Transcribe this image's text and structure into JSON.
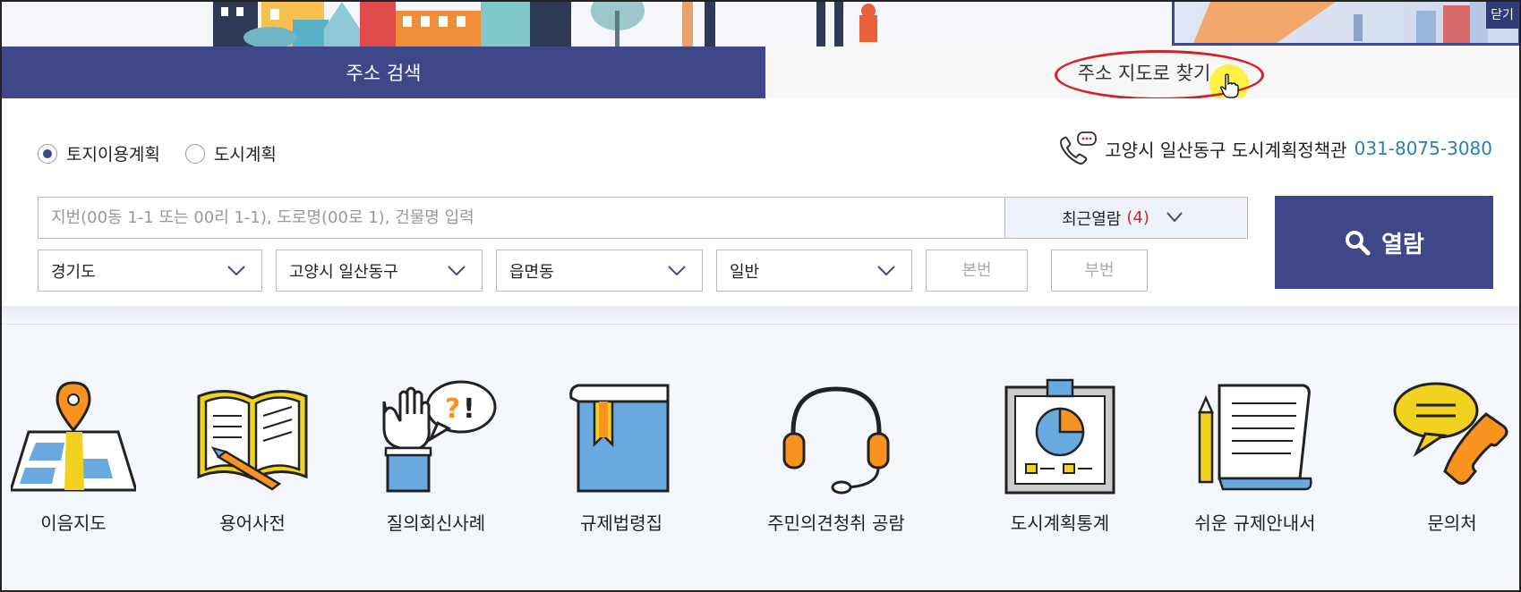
{
  "banner": {
    "close_label": "닫기"
  },
  "tabs": [
    {
      "label": "주소 검색",
      "active": true
    },
    {
      "label": "주소 지도로 찾기",
      "active": false
    }
  ],
  "search": {
    "radios": [
      {
        "label": "토지이용계획",
        "checked": true
      },
      {
        "label": "도시계획",
        "checked": false
      }
    ],
    "contact_text": "고양시 일산동구 도시계획정책관",
    "contact_phone": "031-8075-3080",
    "input_placeholder": "지번(00동 1-1 또는 00리 1-1), 도로명(00로 1), 건물명 입력",
    "recent_label": "최근열람",
    "recent_count": "(4)",
    "button_label": "열람",
    "selects": {
      "province": "경기도",
      "city": "고양시 일산동구",
      "town": "읍면동",
      "type": "일반"
    },
    "main_no_placeholder": "본번",
    "sub_no_placeholder": "부번",
    "dash": "-"
  },
  "quick_menu": [
    {
      "label": "이음지도",
      "icon": "map-pin-icon"
    },
    {
      "label": "용어사전",
      "icon": "open-book-icon"
    },
    {
      "label": "질의회신사례",
      "icon": "question-hand-icon"
    },
    {
      "label": "규제법령집",
      "icon": "law-book-icon"
    },
    {
      "label": "주민의견청취 공람",
      "icon": "headset-icon"
    },
    {
      "label": "도시계획통계",
      "icon": "pie-chart-board-icon"
    },
    {
      "label": "쉬운 규제안내서",
      "icon": "document-pencil-icon"
    },
    {
      "label": "문의처",
      "icon": "phone-chat-icon"
    }
  ],
  "colors": {
    "primary": "#3e4889",
    "accent_red": "#d42026",
    "phone_blue": "#2a7fb5",
    "icon_orange": "#f7931e",
    "icon_blue": "#6aa8e0",
    "icon_yellow": "#f0d21f"
  }
}
